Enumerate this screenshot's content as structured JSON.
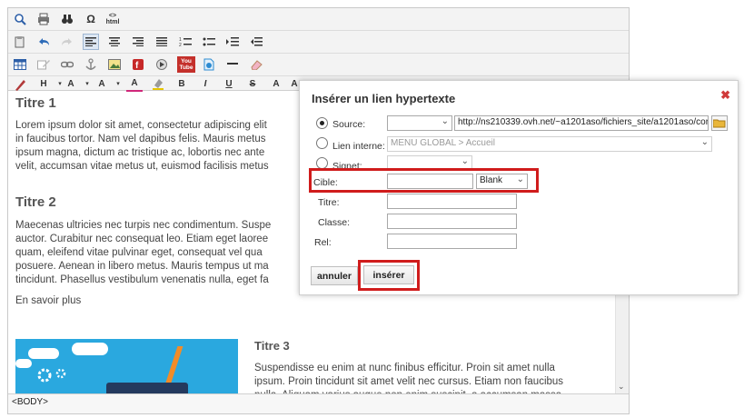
{
  "toolbar": {
    "row1": [
      "zoom-icon",
      "print-icon",
      "binoculars-icon",
      "omega-icon",
      "html-icon"
    ],
    "row1_labels": {
      "omega": "Ω",
      "html": "<>\nhtml"
    },
    "row2": [
      "paste-icon",
      "undo-icon",
      "redo-icon",
      "align-left-icon",
      "align-center-icon",
      "align-right-icon",
      "justify-icon",
      "ordered-list-icon",
      "unordered-list-icon",
      "indent-icon",
      "outdent-icon"
    ],
    "row3": [
      "table-icon",
      "edit-icon",
      "link-icon",
      "anchor-icon",
      "image-icon",
      "flash-icon",
      "media-icon",
      "youtube-icon",
      "file-icon",
      "hr-icon",
      "eraser-icon"
    ],
    "row3_labels": {
      "youtube": "You\nTube"
    },
    "row4_labels": {
      "heading": "H",
      "font": "A",
      "size": "A",
      "bold": "B",
      "italic": "I",
      "underline": "U",
      "strike": "S",
      "super": "A",
      "sub": "A"
    }
  },
  "content": {
    "t1": "Titre 1",
    "p1": "Lorem ipsum dolor sit amet, consectetur adipiscing elit\nin faucibus tortor. Nam vel dapibus felis. Mauris metus\nipsum magna, dictum ac tristique ac, lobortis nec ante\nvelit, accumsan vitae metus ut, euismod facilisis metus",
    "t2": "Titre 2",
    "p2": "Maecenas ultricies nec turpis nec condimentum. Suspe\nauctor. Curabitur nec consequat leo. Etiam eget laoree\nquam, eleifend vitae pulvinar eget, consequat vel qua\nposuere. Aenean in libero metus. Mauris tempus ut ma\ntincidunt. Phasellus vestibulum venenatis nulla, eget fa",
    "more": "En savoir plus",
    "t3": "Titre 3",
    "p3": "Suspendisse eu enim at nunc finibus efficitur. Proin sit amet nulla\nipsum. Proin tincidunt sit amet velit nec cursus. Etiam non faucibus\nnulla. Aliquam varius augue non enim suscipit, a accumsan massa"
  },
  "status": "<BODY>",
  "dialog": {
    "title": "Insérer un lien hypertexte",
    "close": "✖",
    "source_label": "Source:",
    "source_url": "http://ns210339.ovh.net/~a1201aso/fichiers_site/a1201aso/cor",
    "internal_label": "Lien interne:",
    "internal_value": "MENU GLOBAL > Accueil",
    "anchor_label": "Signet:",
    "target_label": "Cible:",
    "target_value": "Blank",
    "title_label": "Titre:",
    "class_label": "Classe:",
    "rel_label": "Rel:",
    "cancel_label": "annuler",
    "insert_label": "insérer",
    "selected_source": "source",
    "highlight_color": "#d01c1c"
  }
}
